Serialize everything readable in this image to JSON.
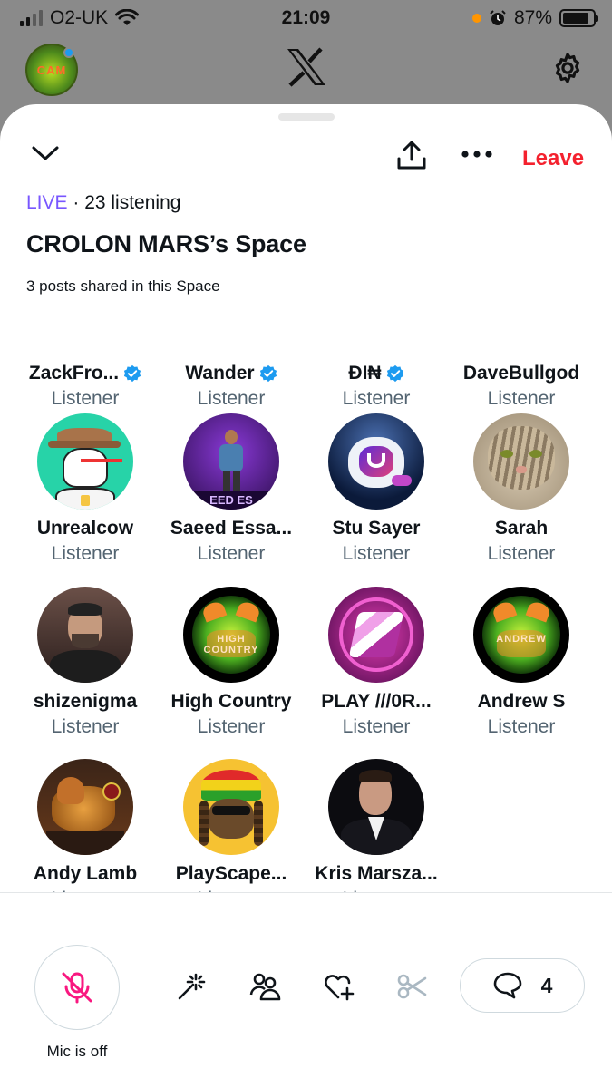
{
  "status_bar": {
    "carrier": "O2-UK",
    "time": "21:09",
    "battery_percent": "87%",
    "battery_level": 0.87
  },
  "app_header": {
    "avatar_text": "CAM"
  },
  "space": {
    "leave_label": "Leave",
    "live_label": "LIVE",
    "listening_text": "· 23 listening",
    "title": "CROLON MARS’s Space",
    "posts_shared": "3 posts shared in this Space"
  },
  "participants": [
    {
      "name": "ZackFro...",
      "role": "Listener",
      "verified": true,
      "avatar": "person-dark-top"
    },
    {
      "name": "Wander",
      "role": "Listener",
      "verified": true,
      "avatar": "dark-top"
    },
    {
      "name": "ĐΙ₦",
      "role": "Listener",
      "verified": true,
      "avatar": "red-top"
    },
    {
      "name": "DaveBullgod",
      "role": "Listener",
      "verified": false,
      "avatar": "light-top"
    },
    {
      "name": "Unrealcow",
      "role": "Listener",
      "verified": false,
      "avatar": "cartoon-cow"
    },
    {
      "name": "Saeed Essa...",
      "role": "Listener",
      "verified": false,
      "avatar": "purple-3d-figure",
      "avatar_text": "EED ES"
    },
    {
      "name": "Stu Sayer",
      "role": "Listener",
      "verified": false,
      "avatar": "astronaut-globe"
    },
    {
      "name": "Sarah",
      "role": "Listener",
      "verified": false,
      "avatar": "tabby-cat"
    },
    {
      "name": "shizenigma",
      "role": "Listener",
      "verified": false,
      "avatar": "man-in-car"
    },
    {
      "name": "High Country",
      "role": "Listener",
      "verified": false,
      "avatar": "green-glow",
      "avatar_text": "HIGH COUNTRY"
    },
    {
      "name": "PLAY ///0R...",
      "role": "Listener",
      "verified": false,
      "avatar": "pink-logo"
    },
    {
      "name": "Andrew S",
      "role": "Listener",
      "verified": false,
      "avatar": "green-glow",
      "avatar_text": "ANDREW"
    },
    {
      "name": "Andy Lamb",
      "role": "Listener",
      "verified": false,
      "avatar": "dragon"
    },
    {
      "name": "PlayScape...",
      "role": "Listener",
      "verified": false,
      "avatar": "rasta-cartoon"
    },
    {
      "name": "Kris Marsza...",
      "role": "Listener",
      "verified": false,
      "avatar": "man-in-suit"
    }
  ],
  "bottom_bar": {
    "mic_label": "Mic is off",
    "comment_count": "4",
    "tools": [
      "magic-wand-icon",
      "people-icon",
      "heart-plus-icon",
      "scissors-icon"
    ]
  },
  "colors": {
    "live": "#7856ff",
    "leave": "#f4212e",
    "verified": "#1d9bf0",
    "mic_off": "#f91880",
    "secondary_text": "#536471"
  }
}
